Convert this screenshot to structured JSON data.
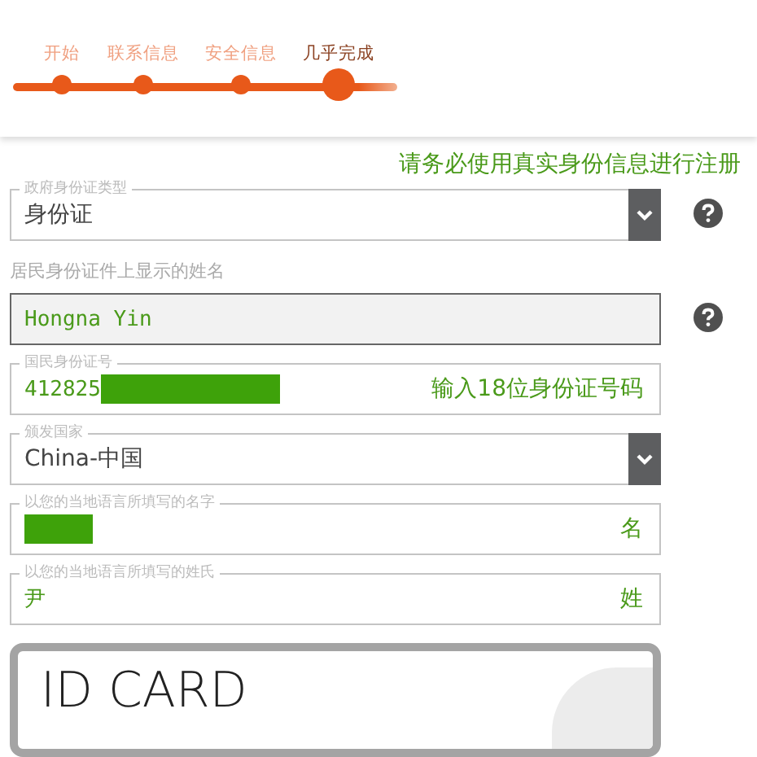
{
  "steps": [
    {
      "label": "开始",
      "selected": false
    },
    {
      "label": "联系信息",
      "selected": false
    },
    {
      "label": "安全信息",
      "selected": false
    },
    {
      "label": "几乎完成",
      "selected": true
    }
  ],
  "notice": "请务必使用真实身份信息进行注册",
  "fields": [
    {
      "kind": "select",
      "legend": "政府身份证类型",
      "value": "身份证",
      "help": true
    },
    {
      "kind": "readonly",
      "label": "居民身份证件上显示的姓名",
      "value": "Hongna Yin",
      "help": true
    },
    {
      "kind": "text",
      "legend": "国民身份证号",
      "value": "412825",
      "redacted": true,
      "hint": "输入18位身份证号码"
    },
    {
      "kind": "select",
      "legend": "颁发国家",
      "value": "China-中国"
    },
    {
      "kind": "text",
      "legend": "以您的当地语言所填写的名字",
      "redacted": true,
      "hint": "名"
    },
    {
      "kind": "text",
      "legend": "以您的当地语言所填写的姓氏",
      "value": "尹",
      "hint": "姓"
    }
  ],
  "card": {
    "title": "ID CARD"
  }
}
